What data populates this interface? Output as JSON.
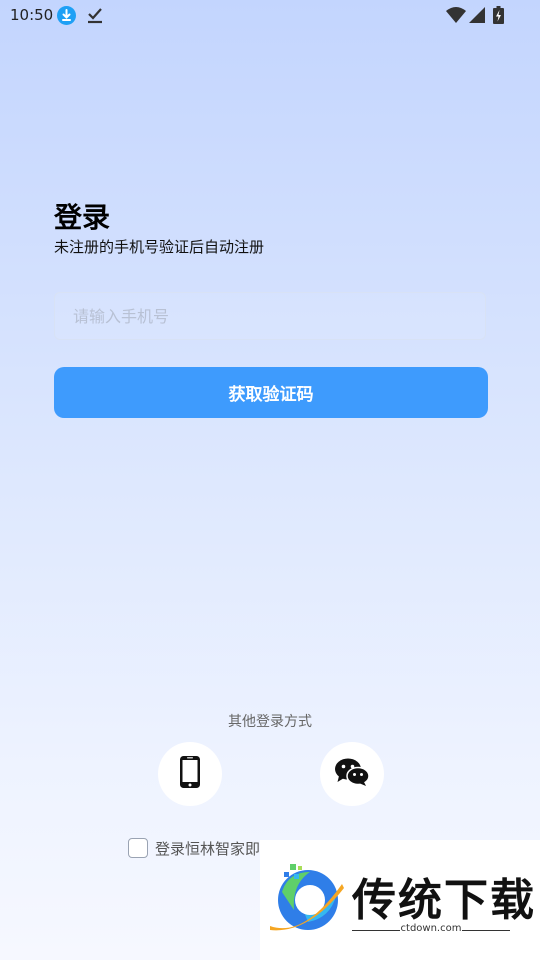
{
  "status_bar": {
    "time": "10:50",
    "icons": [
      "download-icon",
      "check-icon",
      "wifi-icon",
      "signal-icon",
      "battery-icon"
    ]
  },
  "login": {
    "title": "登录",
    "subtitle": "未注册的手机号验证后自动注册",
    "phone_placeholder": "请输入手机号",
    "phone_value": "",
    "get_code_label": "获取验证码"
  },
  "other_login": {
    "label": "其他登录方式",
    "methods": [
      "phone-icon",
      "wechat-icon"
    ]
  },
  "agreement": {
    "text": "登录恒林智家即",
    "checked": false
  },
  "watermark": {
    "text": "传统下载",
    "url": "ctdown.com"
  },
  "colors": {
    "primary": "#3e9bfd",
    "background_top": "#c3d5fe",
    "background_bottom": "#f6f8ff"
  }
}
